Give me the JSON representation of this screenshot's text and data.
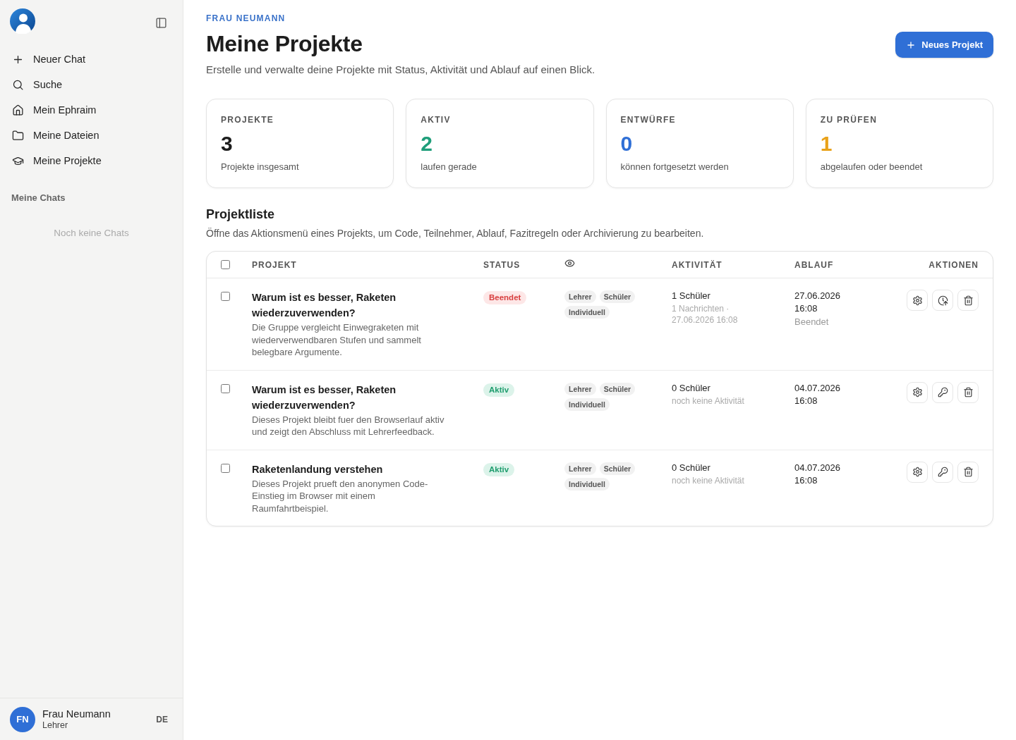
{
  "sidebar": {
    "nav_items": [
      "Neuer Chat",
      "Suche",
      "Mein Ephraim",
      "Meine Dateien",
      "Meine Projekte"
    ],
    "chats_heading": "Meine Chats",
    "chats_empty": "Noch keine Chats",
    "user": {
      "initials": "FN",
      "name": "Frau Neumann",
      "role": "Lehrer",
      "language": "DE"
    }
  },
  "header": {
    "eyebrow": "FRAU NEUMANN",
    "title": "Meine Projekte",
    "subtitle": "Erstelle und verwalte deine Projekte mit Status, Aktivität und Ablauf auf einen Blick.",
    "new_button": "Neues Projekt"
  },
  "stats": [
    {
      "label": "PROJEKTE",
      "value": "3",
      "caption": "Projekte insgesamt",
      "color": "#1d1d1d"
    },
    {
      "label": "AKTIV",
      "value": "2",
      "caption": "laufen gerade",
      "color": "#1f9e7a"
    },
    {
      "label": "ENTWÜRFE",
      "value": "0",
      "caption": "können fortgesetzt werden",
      "color": "#2f6fd6"
    },
    {
      "label": "ZU PRÜFEN",
      "value": "1",
      "caption": "abgelaufen oder beendet",
      "color": "#e9a21a"
    }
  ],
  "project_list": {
    "title": "Projektliste",
    "description": "Öffne das Aktionsmenü eines Projekts, um Code, Teilnehmer, Ablauf, Fazitregeln oder Archivierung zu bearbeiten.",
    "all_checked": false,
    "columns": [
      {
        "kind": "text",
        "label": "PROJEKT"
      },
      {
        "kind": "text",
        "label": "STATUS"
      },
      {
        "kind": "visibility"
      },
      {
        "kind": "text",
        "label": "AKTIVITÄT"
      },
      {
        "kind": "text",
        "label": "ABLAUF"
      },
      {
        "kind": "text",
        "label": "AKTIONEN"
      }
    ],
    "rows": [
      {
        "checked": false,
        "title": "Warum ist es besser, Raketen wiederzuverwenden?",
        "description": "Die Gruppe vergleicht Einwegraketen mit wiederverwendbaren Stufen und sammelt belegbare Argumente.",
        "status": {
          "label": "Beendet",
          "kind": "ended"
        },
        "visibility": [
          "Lehrer",
          "Schüler",
          "Individuell"
        ],
        "activity": {
          "count": "1 Schüler",
          "detail": "1 Nachrichten · 27.06.2026 16:08"
        },
        "expiry": {
          "date": "27.06.2026 16:08",
          "note": "Beendet"
        },
        "actions": [
          {
            "kind": "settings"
          },
          {
            "kind": "reopen"
          },
          {
            "kind": "delete"
          }
        ]
      },
      {
        "checked": false,
        "title": "Warum ist es besser, Raketen wiederzuverwenden?",
        "description": "Dieses Projekt bleibt fuer den Browserlauf aktiv und zeigt den Abschluss mit Lehrerfeedback.",
        "status": {
          "label": "Aktiv",
          "kind": "active"
        },
        "visibility": [
          "Lehrer",
          "Schüler",
          "Individuell"
        ],
        "activity": {
          "count": "0 Schüler",
          "detail": "noch keine Aktivität"
        },
        "expiry": {
          "date": "04.07.2026 16:08"
        },
        "actions": [
          {
            "kind": "settings"
          },
          {
            "kind": "access"
          },
          {
            "kind": "delete"
          }
        ]
      },
      {
        "checked": false,
        "title": "Raketenlandung verstehen",
        "description": "Dieses Projekt prueft den anonymen Code-Einstieg im Browser mit einem Raumfahrtbeispiel.",
        "status": {
          "label": "Aktiv",
          "kind": "active"
        },
        "visibility": [
          "Lehrer",
          "Schüler",
          "Individuell"
        ],
        "activity": {
          "count": "0 Schüler",
          "detail": "noch keine Aktivität"
        },
        "expiry": {
          "date": "04.07.2026 16:08"
        },
        "actions": [
          {
            "kind": "settings"
          },
          {
            "kind": "access"
          },
          {
            "kind": "delete"
          }
        ]
      }
    ]
  }
}
